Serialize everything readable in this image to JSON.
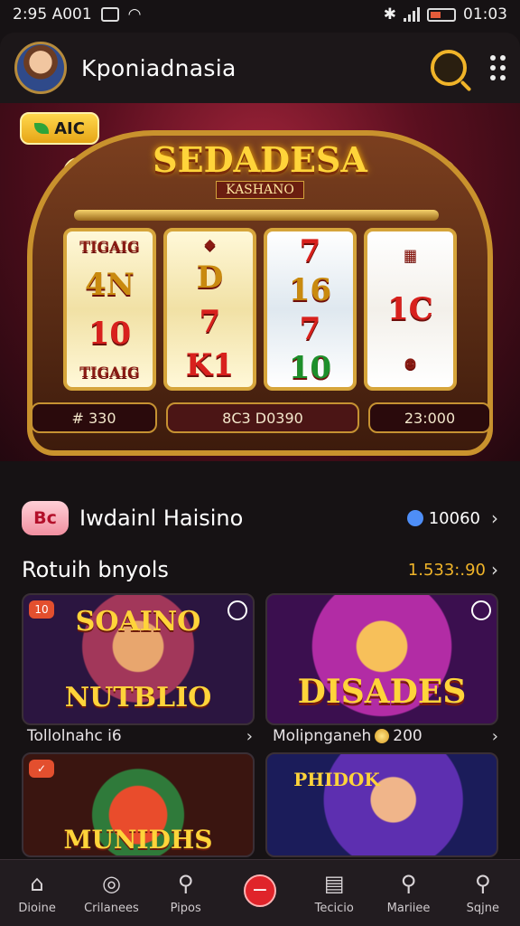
{
  "status": {
    "time": "2:95 A001",
    "right": "01:03"
  },
  "header": {
    "title": "Kponiadnasia"
  },
  "hero": {
    "pill": "AIC",
    "title": "SEDADESA",
    "subtitle": "KASHANO",
    "reels": [
      [
        "TIGAIG",
        "4N",
        "10",
        "TIGAIG"
      ],
      [
        "",
        "D",
        "7",
        "K1"
      ],
      [
        "7",
        "16",
        "7",
        "10"
      ],
      [
        "",
        "1C",
        ""
      ]
    ],
    "bet_left": "# 330",
    "bet_center": "8C3 D0390",
    "bet_right": "23:000"
  },
  "section1": {
    "badge": "Bc",
    "title": "Iwdainl Haisino",
    "count": "10060"
  },
  "section2": {
    "title": "Rotuih bnyols",
    "amount": "1.533:.90"
  },
  "cards": [
    {
      "label": "NUTBLIO",
      "top_label": "SOAINO",
      "corner": "10"
    },
    {
      "label": "DISADES",
      "corner": ""
    },
    {
      "label": "MUNIDHS"
    },
    {
      "label": "PHIDOK"
    }
  ],
  "captions": [
    {
      "text": "Tollolnahc i6"
    },
    {
      "text": "Molipnganeh",
      "amount": "200"
    }
  ],
  "tabs": [
    {
      "label": "Dioine",
      "icon": "home-icon"
    },
    {
      "label": "Crilanees",
      "icon": "compass-icon"
    },
    {
      "label": "Pipos",
      "icon": "search-icon"
    },
    {
      "label": "",
      "icon": "minus-icon"
    },
    {
      "label": "Tecicio",
      "icon": "list-icon"
    },
    {
      "label": "Mariiee",
      "icon": "search-badge-icon"
    },
    {
      "label": "Sqjne",
      "icon": "search-alt-icon"
    }
  ]
}
